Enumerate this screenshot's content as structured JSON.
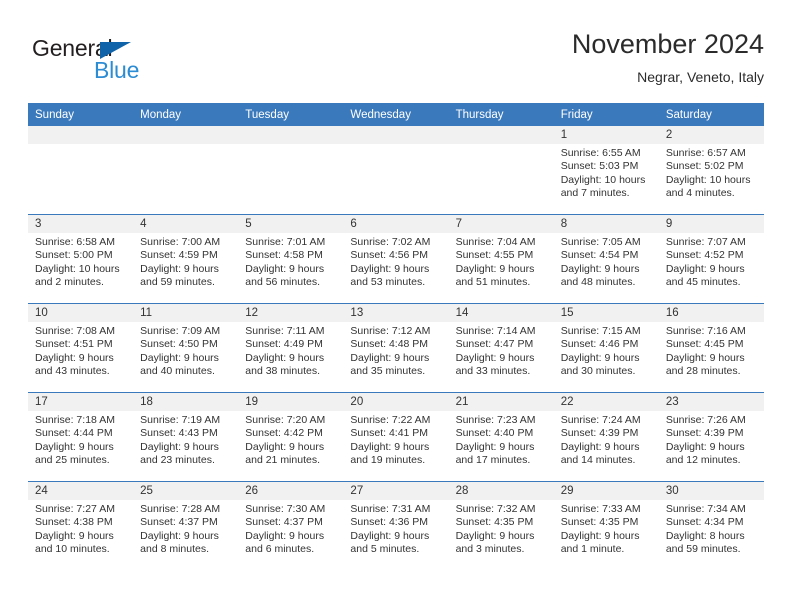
{
  "brand": {
    "name_part1": "General",
    "name_part2": "Blue",
    "triangle_color": "#1063a8",
    "text_color": "#231f20",
    "accent_color": "#2b8cd4"
  },
  "header": {
    "title": "November 2024",
    "subtitle": "Negrar, Veneto, Italy"
  },
  "theme": {
    "header_blue": "#3b79bd",
    "daynum_band": "#f1f1f1",
    "text": "#333333"
  },
  "calendar": {
    "weekday_headers": [
      "Sunday",
      "Monday",
      "Tuesday",
      "Wednesday",
      "Thursday",
      "Friday",
      "Saturday"
    ],
    "weeks": [
      [
        {
          "day": "",
          "empty": true
        },
        {
          "day": "",
          "empty": true
        },
        {
          "day": "",
          "empty": true
        },
        {
          "day": "",
          "empty": true
        },
        {
          "day": "",
          "empty": true
        },
        {
          "day": "1",
          "sunrise": "Sunrise: 6:55 AM",
          "sunset": "Sunset: 5:03 PM",
          "daylight": "Daylight: 10 hours and 7 minutes."
        },
        {
          "day": "2",
          "sunrise": "Sunrise: 6:57 AM",
          "sunset": "Sunset: 5:02 PM",
          "daylight": "Daylight: 10 hours and 4 minutes."
        }
      ],
      [
        {
          "day": "3",
          "sunrise": "Sunrise: 6:58 AM",
          "sunset": "Sunset: 5:00 PM",
          "daylight": "Daylight: 10 hours and 2 minutes."
        },
        {
          "day": "4",
          "sunrise": "Sunrise: 7:00 AM",
          "sunset": "Sunset: 4:59 PM",
          "daylight": "Daylight: 9 hours and 59 minutes."
        },
        {
          "day": "5",
          "sunrise": "Sunrise: 7:01 AM",
          "sunset": "Sunset: 4:58 PM",
          "daylight": "Daylight: 9 hours and 56 minutes."
        },
        {
          "day": "6",
          "sunrise": "Sunrise: 7:02 AM",
          "sunset": "Sunset: 4:56 PM",
          "daylight": "Daylight: 9 hours and 53 minutes."
        },
        {
          "day": "7",
          "sunrise": "Sunrise: 7:04 AM",
          "sunset": "Sunset: 4:55 PM",
          "daylight": "Daylight: 9 hours and 51 minutes."
        },
        {
          "day": "8",
          "sunrise": "Sunrise: 7:05 AM",
          "sunset": "Sunset: 4:54 PM",
          "daylight": "Daylight: 9 hours and 48 minutes."
        },
        {
          "day": "9",
          "sunrise": "Sunrise: 7:07 AM",
          "sunset": "Sunset: 4:52 PM",
          "daylight": "Daylight: 9 hours and 45 minutes."
        }
      ],
      [
        {
          "day": "10",
          "sunrise": "Sunrise: 7:08 AM",
          "sunset": "Sunset: 4:51 PM",
          "daylight": "Daylight: 9 hours and 43 minutes."
        },
        {
          "day": "11",
          "sunrise": "Sunrise: 7:09 AM",
          "sunset": "Sunset: 4:50 PM",
          "daylight": "Daylight: 9 hours and 40 minutes."
        },
        {
          "day": "12",
          "sunrise": "Sunrise: 7:11 AM",
          "sunset": "Sunset: 4:49 PM",
          "daylight": "Daylight: 9 hours and 38 minutes."
        },
        {
          "day": "13",
          "sunrise": "Sunrise: 7:12 AM",
          "sunset": "Sunset: 4:48 PM",
          "daylight": "Daylight: 9 hours and 35 minutes."
        },
        {
          "day": "14",
          "sunrise": "Sunrise: 7:14 AM",
          "sunset": "Sunset: 4:47 PM",
          "daylight": "Daylight: 9 hours and 33 minutes."
        },
        {
          "day": "15",
          "sunrise": "Sunrise: 7:15 AM",
          "sunset": "Sunset: 4:46 PM",
          "daylight": "Daylight: 9 hours and 30 minutes."
        },
        {
          "day": "16",
          "sunrise": "Sunrise: 7:16 AM",
          "sunset": "Sunset: 4:45 PM",
          "daylight": "Daylight: 9 hours and 28 minutes."
        }
      ],
      [
        {
          "day": "17",
          "sunrise": "Sunrise: 7:18 AM",
          "sunset": "Sunset: 4:44 PM",
          "daylight": "Daylight: 9 hours and 25 minutes."
        },
        {
          "day": "18",
          "sunrise": "Sunrise: 7:19 AM",
          "sunset": "Sunset: 4:43 PM",
          "daylight": "Daylight: 9 hours and 23 minutes."
        },
        {
          "day": "19",
          "sunrise": "Sunrise: 7:20 AM",
          "sunset": "Sunset: 4:42 PM",
          "daylight": "Daylight: 9 hours and 21 minutes."
        },
        {
          "day": "20",
          "sunrise": "Sunrise: 7:22 AM",
          "sunset": "Sunset: 4:41 PM",
          "daylight": "Daylight: 9 hours and 19 minutes."
        },
        {
          "day": "21",
          "sunrise": "Sunrise: 7:23 AM",
          "sunset": "Sunset: 4:40 PM",
          "daylight": "Daylight: 9 hours and 17 minutes."
        },
        {
          "day": "22",
          "sunrise": "Sunrise: 7:24 AM",
          "sunset": "Sunset: 4:39 PM",
          "daylight": "Daylight: 9 hours and 14 minutes."
        },
        {
          "day": "23",
          "sunrise": "Sunrise: 7:26 AM",
          "sunset": "Sunset: 4:39 PM",
          "daylight": "Daylight: 9 hours and 12 minutes."
        }
      ],
      [
        {
          "day": "24",
          "sunrise": "Sunrise: 7:27 AM",
          "sunset": "Sunset: 4:38 PM",
          "daylight": "Daylight: 9 hours and 10 minutes."
        },
        {
          "day": "25",
          "sunrise": "Sunrise: 7:28 AM",
          "sunset": "Sunset: 4:37 PM",
          "daylight": "Daylight: 9 hours and 8 minutes."
        },
        {
          "day": "26",
          "sunrise": "Sunrise: 7:30 AM",
          "sunset": "Sunset: 4:37 PM",
          "daylight": "Daylight: 9 hours and 6 minutes."
        },
        {
          "day": "27",
          "sunrise": "Sunrise: 7:31 AM",
          "sunset": "Sunset: 4:36 PM",
          "daylight": "Daylight: 9 hours and 5 minutes."
        },
        {
          "day": "28",
          "sunrise": "Sunrise: 7:32 AM",
          "sunset": "Sunset: 4:35 PM",
          "daylight": "Daylight: 9 hours and 3 minutes."
        },
        {
          "day": "29",
          "sunrise": "Sunrise: 7:33 AM",
          "sunset": "Sunset: 4:35 PM",
          "daylight": "Daylight: 9 hours and 1 minute."
        },
        {
          "day": "30",
          "sunrise": "Sunrise: 7:34 AM",
          "sunset": "Sunset: 4:34 PM",
          "daylight": "Daylight: 8 hours and 59 minutes."
        }
      ]
    ]
  }
}
